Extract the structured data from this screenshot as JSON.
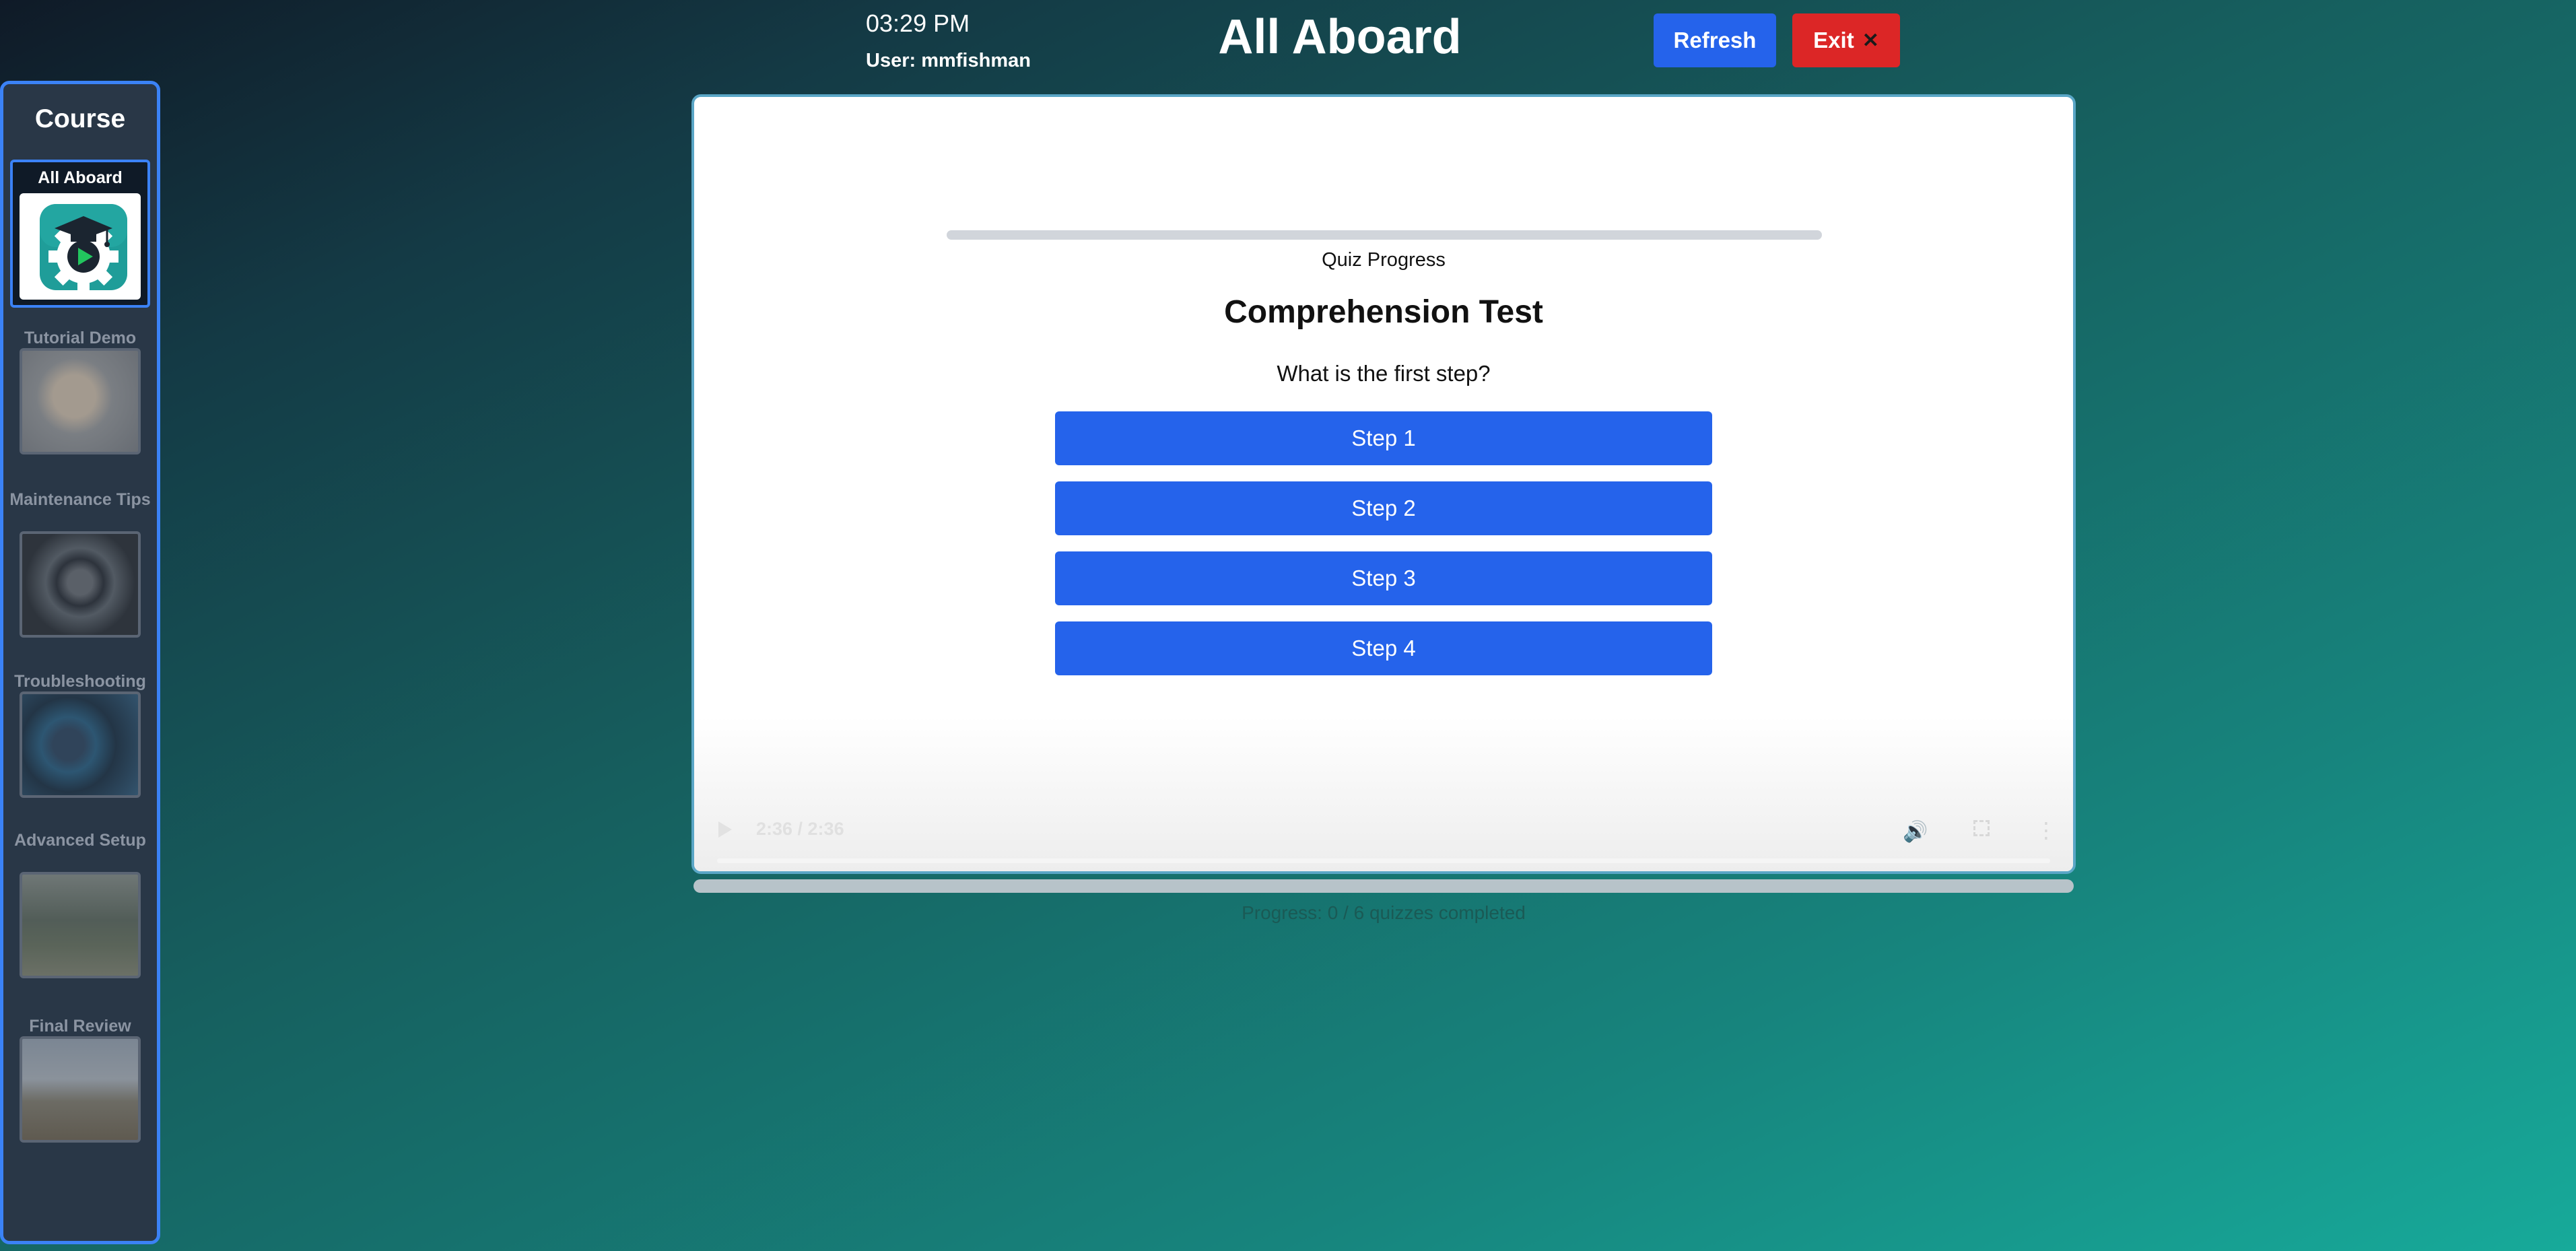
{
  "header": {
    "time": "03:29 PM",
    "user": "User: mmfishman",
    "title": "All Aboard",
    "refresh_label": "Refresh",
    "exit_label": "Exit",
    "exit_icon": "✕"
  },
  "sidebar": {
    "title": "Course",
    "items": [
      {
        "label": "All Aboard",
        "active": true
      },
      {
        "label": "Tutorial Demo",
        "active": false
      },
      {
        "label": "Maintenance Tips",
        "active": false
      },
      {
        "label": "Troubleshooting",
        "active": false
      },
      {
        "label": "Advanced Setup",
        "active": false
      },
      {
        "label": "Final Review",
        "active": false
      }
    ]
  },
  "quiz": {
    "progress_label": "Quiz Progress",
    "progress_fraction": 0,
    "title": "Comprehension Test",
    "question": "What is the first step?",
    "answers": [
      "Step 1",
      "Step 2",
      "Step 3",
      "Step 4"
    ]
  },
  "video": {
    "time": "2:36 / 2:36"
  },
  "course_progress": {
    "text": "Progress: 0 / 6 quizzes completed",
    "completed": 0,
    "total": 6
  },
  "colors": {
    "accent": "#2563eb",
    "danger": "#dc2626",
    "sidebar_bg": "#293747",
    "sidebar_border": "#3b82f6"
  },
  "icons": {
    "course_icon": "graduation-cap-gear-play-icon",
    "play": "play-icon",
    "volume": "volume-icon",
    "fullscreen": "fullscreen-icon",
    "more": "more-vertical-icon"
  }
}
